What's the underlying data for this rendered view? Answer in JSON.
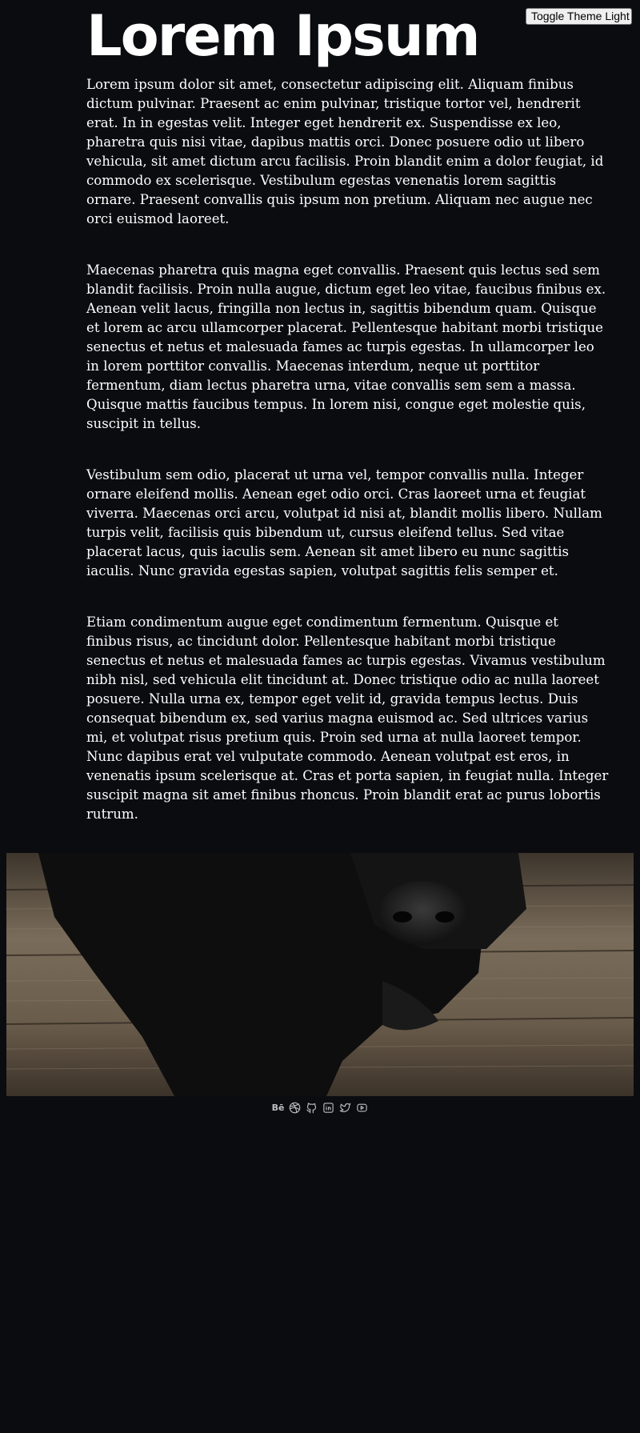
{
  "header": {
    "toggle_label": "Toggle Theme Light"
  },
  "main": {
    "title": "Lorem Ipsum",
    "paragraphs": [
      {
        "lines": [
          "Lorem ipsum dolor sit amet, consectetur adipiscing elit. Aliquam finibus",
          "dictum pulvinar. Praesent ac enim pulvinar, tristique tortor vel, hendrerit",
          "erat. In in egestas velit. Integer eget hendrerit ex. Suspendisse ex leo,",
          "pharetra quis nisi vitae, dapibus mattis orci. Donec posuere odio ut libero",
          "vehicula, sit amet dictum arcu facilisis. Proin blandit enim a dolor feugiat, id",
          "commodo ex scelerisque. Vestibulum egestas venenatis lorem sagittis",
          "ornare. Praesent convallis quis ipsum non pretium. Aliquam nec augue nec",
          "orci euismod laoreet."
        ]
      },
      {
        "lines": [
          "Maecenas pharetra quis magna eget convallis. Praesent quis lectus sed sem",
          "blandit facilisis. Proin nulla augue, dictum eget leo vitae, faucibus finibus ex.",
          "Aenean velit lacus, fringilla non lectus in, sagittis bibendum quam. Quisque",
          "et lorem ac arcu ullamcorper placerat. Pellentesque habitant morbi tristique",
          "senectus et netus et malesuada fames ac turpis egestas. In ullamcorper leo",
          "in lorem porttitor convallis. Maecenas interdum, neque ut porttitor",
          "fermentum, diam lectus pharetra urna, vitae convallis sem sem a massa.",
          "Quisque mattis faucibus tempus. In lorem nisi, congue eget molestie quis,",
          "suscipit in tellus."
        ]
      },
      {
        "lines": [
          "Vestibulum sem odio, placerat ut urna vel, tempor convallis nulla. Integer",
          "ornare eleifend mollis. Aenean eget odio orci. Cras laoreet urna et feugiat",
          "viverra. Maecenas orci arcu, volutpat id nisi at, blandit mollis libero. Nullam",
          "turpis velit, facilisis quis bibendum ut, cursus eleifend tellus. Sed vitae",
          "placerat lacus, quis iaculis sem. Aenean sit amet libero eu nunc sagittis",
          "iaculis. Nunc gravida egestas sapien, volutpat sagittis felis semper et."
        ]
      },
      {
        "lines": [
          "Etiam condimentum augue eget condimentum fermentum. Quisque et",
          "finibus risus, ac tincidunt dolor. Pellentesque habitant morbi tristique",
          "senectus et netus et malesuada fames ac turpis egestas. Vivamus vestibulum",
          "nibh nisl, sed vehicula elit tincidunt at. Donec tristique odio ac nulla laoreet",
          "posuere. Nulla urna ex, tempor eget velit id, gravida tempus lectus. Duis",
          "consequat bibendum ex, sed varius magna euismod ac. Sed ultrices varius",
          "mi, et volutpat risus pretium quis. Proin sed urna at nulla laoreet tempor.",
          "Nunc dapibus erat vel vulputate commodo. Aenean volutpat est eros, in",
          "venenatis ipsum scelerisque at. Cras et porta sapien, in feugiat nulla. Integer",
          "suscipit magna sit amet finibus rhoncus. Proin blandit erat ac purus lobortis",
          "rutrum."
        ]
      }
    ]
  },
  "hero_image": {
    "subject": "black dog resting head on wooden floor"
  },
  "footer": {
    "social": [
      {
        "icon": "behance-icon",
        "text": "Bē"
      },
      {
        "icon": "dribbble-icon"
      },
      {
        "icon": "github-icon"
      },
      {
        "icon": "linkedin-icon"
      },
      {
        "icon": "twitter-icon"
      },
      {
        "icon": "youtube-icon"
      }
    ]
  },
  "colors": {
    "background": "#0b0c10",
    "text": "#ffffff",
    "icon": "#bfbfbf"
  }
}
